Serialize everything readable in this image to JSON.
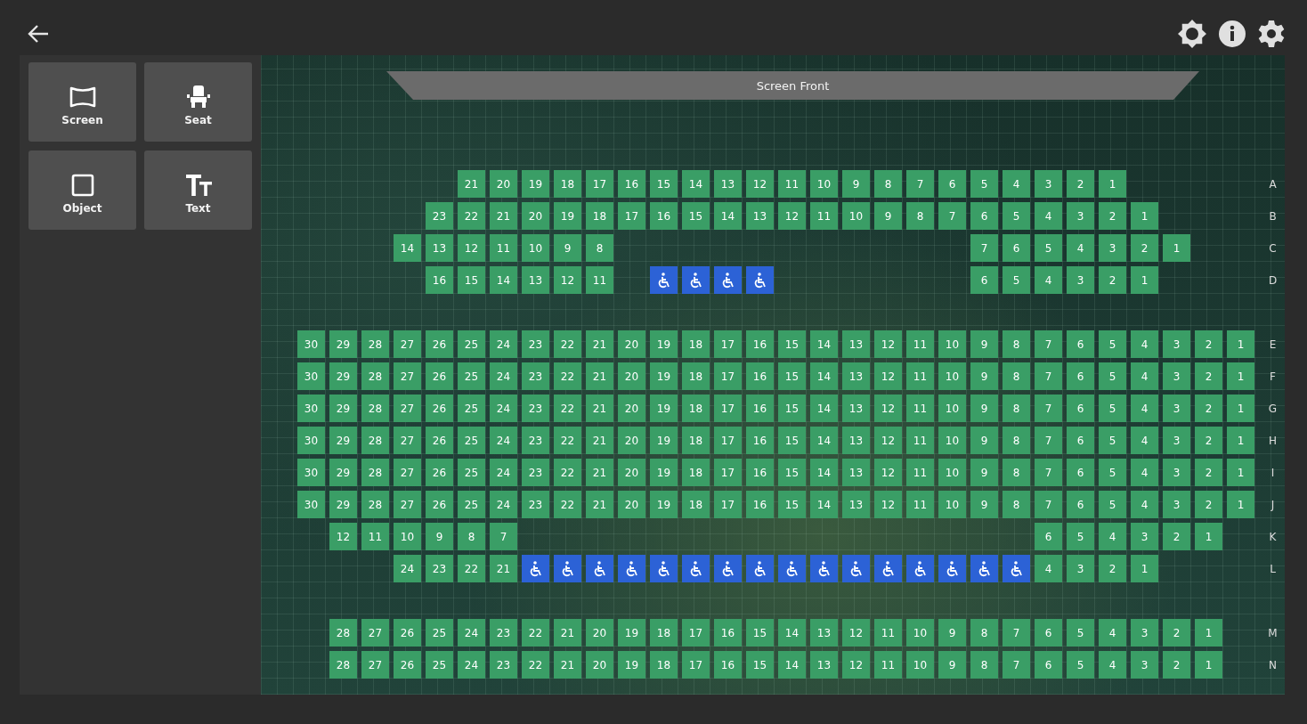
{
  "toolbar": {
    "tools": [
      {
        "kind": "screen",
        "label": "Screen"
      },
      {
        "kind": "seat",
        "label": "Seat"
      },
      {
        "kind": "object",
        "label": "Object"
      },
      {
        "kind": "text",
        "label": "Text"
      }
    ]
  },
  "screen": {
    "label": "Screen Front"
  },
  "rows": [
    {
      "kind": "row",
      "label": "A",
      "seats": [
        {
          "kind": "gap"
        },
        {
          "kind": "gap"
        },
        {
          "kind": "gap"
        },
        {
          "kind": "gap"
        },
        {
          "kind": "gap"
        },
        {
          "kind": "seat",
          "label": "21"
        },
        {
          "kind": "seat",
          "label": "20"
        },
        {
          "kind": "seat",
          "label": "19"
        },
        {
          "kind": "seat",
          "label": "18"
        },
        {
          "kind": "seat",
          "label": "17"
        },
        {
          "kind": "seat",
          "label": "16"
        },
        {
          "kind": "seat",
          "label": "15"
        },
        {
          "kind": "seat",
          "label": "14"
        },
        {
          "kind": "seat",
          "label": "13"
        },
        {
          "kind": "seat",
          "label": "12"
        },
        {
          "kind": "seat",
          "label": "11"
        },
        {
          "kind": "seat",
          "label": "10"
        },
        {
          "kind": "seat",
          "label": "9"
        },
        {
          "kind": "seat",
          "label": "8"
        },
        {
          "kind": "seat",
          "label": "7"
        },
        {
          "kind": "seat",
          "label": "6"
        },
        {
          "kind": "seat",
          "label": "5"
        },
        {
          "kind": "seat",
          "label": "4"
        },
        {
          "kind": "seat",
          "label": "3"
        },
        {
          "kind": "seat",
          "label": "2"
        },
        {
          "kind": "seat",
          "label": "1"
        }
      ]
    },
    {
      "kind": "row",
      "label": "B",
      "seats": [
        {
          "kind": "gap"
        },
        {
          "kind": "gap"
        },
        {
          "kind": "gap"
        },
        {
          "kind": "gap"
        },
        {
          "kind": "seat",
          "label": "23"
        },
        {
          "kind": "seat",
          "label": "22"
        },
        {
          "kind": "seat",
          "label": "21"
        },
        {
          "kind": "seat",
          "label": "20"
        },
        {
          "kind": "seat",
          "label": "19"
        },
        {
          "kind": "seat",
          "label": "18"
        },
        {
          "kind": "seat",
          "label": "17"
        },
        {
          "kind": "seat",
          "label": "16"
        },
        {
          "kind": "seat",
          "label": "15"
        },
        {
          "kind": "seat",
          "label": "14"
        },
        {
          "kind": "seat",
          "label": "13"
        },
        {
          "kind": "seat",
          "label": "12"
        },
        {
          "kind": "seat",
          "label": "11"
        },
        {
          "kind": "seat",
          "label": "10"
        },
        {
          "kind": "seat",
          "label": "9"
        },
        {
          "kind": "seat",
          "label": "8"
        },
        {
          "kind": "seat",
          "label": "7"
        },
        {
          "kind": "seat",
          "label": "6"
        },
        {
          "kind": "seat",
          "label": "5"
        },
        {
          "kind": "seat",
          "label": "4"
        },
        {
          "kind": "seat",
          "label": "3"
        },
        {
          "kind": "seat",
          "label": "2"
        },
        {
          "kind": "seat",
          "label": "1"
        }
      ]
    },
    {
      "kind": "row",
      "label": "C",
      "seats": [
        {
          "kind": "gap"
        },
        {
          "kind": "gap"
        },
        {
          "kind": "gap"
        },
        {
          "kind": "seat",
          "label": "14"
        },
        {
          "kind": "seat",
          "label": "13"
        },
        {
          "kind": "seat",
          "label": "12"
        },
        {
          "kind": "seat",
          "label": "11"
        },
        {
          "kind": "seat",
          "label": "10"
        },
        {
          "kind": "seat",
          "label": "9"
        },
        {
          "kind": "seat",
          "label": "8"
        },
        {
          "kind": "gap"
        },
        {
          "kind": "gap"
        },
        {
          "kind": "gap"
        },
        {
          "kind": "gap"
        },
        {
          "kind": "gap"
        },
        {
          "kind": "gap"
        },
        {
          "kind": "gap"
        },
        {
          "kind": "gap"
        },
        {
          "kind": "gap"
        },
        {
          "kind": "gap"
        },
        {
          "kind": "gap"
        },
        {
          "kind": "seat",
          "label": "7"
        },
        {
          "kind": "seat",
          "label": "6"
        },
        {
          "kind": "seat",
          "label": "5"
        },
        {
          "kind": "seat",
          "label": "4"
        },
        {
          "kind": "seat",
          "label": "3"
        },
        {
          "kind": "seat",
          "label": "2"
        },
        {
          "kind": "seat",
          "label": "1"
        }
      ]
    },
    {
      "kind": "row",
      "label": "D",
      "seats": [
        {
          "kind": "gap"
        },
        {
          "kind": "gap"
        },
        {
          "kind": "gap"
        },
        {
          "kind": "gap"
        },
        {
          "kind": "seat",
          "label": "16"
        },
        {
          "kind": "seat",
          "label": "15"
        },
        {
          "kind": "seat",
          "label": "14"
        },
        {
          "kind": "seat",
          "label": "13"
        },
        {
          "kind": "seat",
          "label": "12"
        },
        {
          "kind": "seat",
          "label": "11"
        },
        {
          "kind": "gap"
        },
        {
          "kind": "wheelchair"
        },
        {
          "kind": "wheelchair"
        },
        {
          "kind": "wheelchair"
        },
        {
          "kind": "wheelchair"
        },
        {
          "kind": "gap"
        },
        {
          "kind": "gap"
        },
        {
          "kind": "gap"
        },
        {
          "kind": "gap"
        },
        {
          "kind": "gap"
        },
        {
          "kind": "gap"
        },
        {
          "kind": "seat",
          "label": "6"
        },
        {
          "kind": "seat",
          "label": "5"
        },
        {
          "kind": "seat",
          "label": "4"
        },
        {
          "kind": "seat",
          "label": "3"
        },
        {
          "kind": "seat",
          "label": "2"
        },
        {
          "kind": "seat",
          "label": "1"
        }
      ]
    },
    {
      "kind": "aisle"
    },
    {
      "kind": "row",
      "label": "E",
      "seats": [
        {
          "kind": "seat",
          "label": "30"
        },
        {
          "kind": "seat",
          "label": "29"
        },
        {
          "kind": "seat",
          "label": "28"
        },
        {
          "kind": "seat",
          "label": "27"
        },
        {
          "kind": "seat",
          "label": "26"
        },
        {
          "kind": "seat",
          "label": "25"
        },
        {
          "kind": "seat",
          "label": "24"
        },
        {
          "kind": "seat",
          "label": "23"
        },
        {
          "kind": "seat",
          "label": "22"
        },
        {
          "kind": "seat",
          "label": "21"
        },
        {
          "kind": "seat",
          "label": "20"
        },
        {
          "kind": "seat",
          "label": "19"
        },
        {
          "kind": "seat",
          "label": "18"
        },
        {
          "kind": "seat",
          "label": "17"
        },
        {
          "kind": "seat",
          "label": "16"
        },
        {
          "kind": "seat",
          "label": "15"
        },
        {
          "kind": "seat",
          "label": "14"
        },
        {
          "kind": "seat",
          "label": "13"
        },
        {
          "kind": "seat",
          "label": "12"
        },
        {
          "kind": "seat",
          "label": "11"
        },
        {
          "kind": "seat",
          "label": "10"
        },
        {
          "kind": "seat",
          "label": "9"
        },
        {
          "kind": "seat",
          "label": "8"
        },
        {
          "kind": "seat",
          "label": "7"
        },
        {
          "kind": "seat",
          "label": "6"
        },
        {
          "kind": "seat",
          "label": "5"
        },
        {
          "kind": "seat",
          "label": "4"
        },
        {
          "kind": "seat",
          "label": "3"
        },
        {
          "kind": "seat",
          "label": "2"
        },
        {
          "kind": "seat",
          "label": "1"
        }
      ]
    },
    {
      "kind": "row",
      "label": "F",
      "seats": [
        {
          "kind": "seat",
          "label": "30"
        },
        {
          "kind": "seat",
          "label": "29"
        },
        {
          "kind": "seat",
          "label": "28"
        },
        {
          "kind": "seat",
          "label": "27"
        },
        {
          "kind": "seat",
          "label": "26"
        },
        {
          "kind": "seat",
          "label": "25"
        },
        {
          "kind": "seat",
          "label": "24"
        },
        {
          "kind": "seat",
          "label": "23"
        },
        {
          "kind": "seat",
          "label": "22"
        },
        {
          "kind": "seat",
          "label": "21"
        },
        {
          "kind": "seat",
          "label": "20"
        },
        {
          "kind": "seat",
          "label": "19"
        },
        {
          "kind": "seat",
          "label": "18"
        },
        {
          "kind": "seat",
          "label": "17"
        },
        {
          "kind": "seat",
          "label": "16"
        },
        {
          "kind": "seat",
          "label": "15"
        },
        {
          "kind": "seat",
          "label": "14"
        },
        {
          "kind": "seat",
          "label": "13"
        },
        {
          "kind": "seat",
          "label": "12"
        },
        {
          "kind": "seat",
          "label": "11"
        },
        {
          "kind": "seat",
          "label": "10"
        },
        {
          "kind": "seat",
          "label": "9"
        },
        {
          "kind": "seat",
          "label": "8"
        },
        {
          "kind": "seat",
          "label": "7"
        },
        {
          "kind": "seat",
          "label": "6"
        },
        {
          "kind": "seat",
          "label": "5"
        },
        {
          "kind": "seat",
          "label": "4"
        },
        {
          "kind": "seat",
          "label": "3"
        },
        {
          "kind": "seat",
          "label": "2"
        },
        {
          "kind": "seat",
          "label": "1"
        }
      ]
    },
    {
      "kind": "row",
      "label": "G",
      "seats": [
        {
          "kind": "seat",
          "label": "30"
        },
        {
          "kind": "seat",
          "label": "29"
        },
        {
          "kind": "seat",
          "label": "28"
        },
        {
          "kind": "seat",
          "label": "27"
        },
        {
          "kind": "seat",
          "label": "26"
        },
        {
          "kind": "seat",
          "label": "25"
        },
        {
          "kind": "seat",
          "label": "24"
        },
        {
          "kind": "seat",
          "label": "23"
        },
        {
          "kind": "seat",
          "label": "22"
        },
        {
          "kind": "seat",
          "label": "21"
        },
        {
          "kind": "seat",
          "label": "20"
        },
        {
          "kind": "seat",
          "label": "19"
        },
        {
          "kind": "seat",
          "label": "18"
        },
        {
          "kind": "seat",
          "label": "17"
        },
        {
          "kind": "seat",
          "label": "16"
        },
        {
          "kind": "seat",
          "label": "15"
        },
        {
          "kind": "seat",
          "label": "14"
        },
        {
          "kind": "seat",
          "label": "13"
        },
        {
          "kind": "seat",
          "label": "12"
        },
        {
          "kind": "seat",
          "label": "11"
        },
        {
          "kind": "seat",
          "label": "10"
        },
        {
          "kind": "seat",
          "label": "9"
        },
        {
          "kind": "seat",
          "label": "8"
        },
        {
          "kind": "seat",
          "label": "7"
        },
        {
          "kind": "seat",
          "label": "6"
        },
        {
          "kind": "seat",
          "label": "5"
        },
        {
          "kind": "seat",
          "label": "4"
        },
        {
          "kind": "seat",
          "label": "3"
        },
        {
          "kind": "seat",
          "label": "2"
        },
        {
          "kind": "seat",
          "label": "1"
        }
      ]
    },
    {
      "kind": "row",
      "label": "H",
      "seats": [
        {
          "kind": "seat",
          "label": "30"
        },
        {
          "kind": "seat",
          "label": "29"
        },
        {
          "kind": "seat",
          "label": "28"
        },
        {
          "kind": "seat",
          "label": "27"
        },
        {
          "kind": "seat",
          "label": "26"
        },
        {
          "kind": "seat",
          "label": "25"
        },
        {
          "kind": "seat",
          "label": "24"
        },
        {
          "kind": "seat",
          "label": "23"
        },
        {
          "kind": "seat",
          "label": "22"
        },
        {
          "kind": "seat",
          "label": "21"
        },
        {
          "kind": "seat",
          "label": "20"
        },
        {
          "kind": "seat",
          "label": "19"
        },
        {
          "kind": "seat",
          "label": "18"
        },
        {
          "kind": "seat",
          "label": "17"
        },
        {
          "kind": "seat",
          "label": "16"
        },
        {
          "kind": "seat",
          "label": "15"
        },
        {
          "kind": "seat",
          "label": "14"
        },
        {
          "kind": "seat",
          "label": "13"
        },
        {
          "kind": "seat",
          "label": "12"
        },
        {
          "kind": "seat",
          "label": "11"
        },
        {
          "kind": "seat",
          "label": "10"
        },
        {
          "kind": "seat",
          "label": "9"
        },
        {
          "kind": "seat",
          "label": "8"
        },
        {
          "kind": "seat",
          "label": "7"
        },
        {
          "kind": "seat",
          "label": "6"
        },
        {
          "kind": "seat",
          "label": "5"
        },
        {
          "kind": "seat",
          "label": "4"
        },
        {
          "kind": "seat",
          "label": "3"
        },
        {
          "kind": "seat",
          "label": "2"
        },
        {
          "kind": "seat",
          "label": "1"
        }
      ]
    },
    {
      "kind": "row",
      "label": "I",
      "seats": [
        {
          "kind": "seat",
          "label": "30"
        },
        {
          "kind": "seat",
          "label": "29"
        },
        {
          "kind": "seat",
          "label": "28"
        },
        {
          "kind": "seat",
          "label": "27"
        },
        {
          "kind": "seat",
          "label": "26"
        },
        {
          "kind": "seat",
          "label": "25"
        },
        {
          "kind": "seat",
          "label": "24"
        },
        {
          "kind": "seat",
          "label": "23"
        },
        {
          "kind": "seat",
          "label": "22"
        },
        {
          "kind": "seat",
          "label": "21"
        },
        {
          "kind": "seat",
          "label": "20"
        },
        {
          "kind": "seat",
          "label": "19"
        },
        {
          "kind": "seat",
          "label": "18"
        },
        {
          "kind": "seat",
          "label": "17"
        },
        {
          "kind": "seat",
          "label": "16"
        },
        {
          "kind": "seat",
          "label": "15"
        },
        {
          "kind": "seat",
          "label": "14"
        },
        {
          "kind": "seat",
          "label": "13"
        },
        {
          "kind": "seat",
          "label": "12"
        },
        {
          "kind": "seat",
          "label": "11"
        },
        {
          "kind": "seat",
          "label": "10"
        },
        {
          "kind": "seat",
          "label": "9"
        },
        {
          "kind": "seat",
          "label": "8"
        },
        {
          "kind": "seat",
          "label": "7"
        },
        {
          "kind": "seat",
          "label": "6"
        },
        {
          "kind": "seat",
          "label": "5"
        },
        {
          "kind": "seat",
          "label": "4"
        },
        {
          "kind": "seat",
          "label": "3"
        },
        {
          "kind": "seat",
          "label": "2"
        },
        {
          "kind": "seat",
          "label": "1"
        }
      ]
    },
    {
      "kind": "row",
      "label": "J",
      "seats": [
        {
          "kind": "seat",
          "label": "30"
        },
        {
          "kind": "seat",
          "label": "29"
        },
        {
          "kind": "seat",
          "label": "28"
        },
        {
          "kind": "seat",
          "label": "27"
        },
        {
          "kind": "seat",
          "label": "26"
        },
        {
          "kind": "seat",
          "label": "25"
        },
        {
          "kind": "seat",
          "label": "24"
        },
        {
          "kind": "seat",
          "label": "23"
        },
        {
          "kind": "seat",
          "label": "22"
        },
        {
          "kind": "seat",
          "label": "21"
        },
        {
          "kind": "seat",
          "label": "20"
        },
        {
          "kind": "seat",
          "label": "19"
        },
        {
          "kind": "seat",
          "label": "18"
        },
        {
          "kind": "seat",
          "label": "17"
        },
        {
          "kind": "seat",
          "label": "16"
        },
        {
          "kind": "seat",
          "label": "15"
        },
        {
          "kind": "seat",
          "label": "14"
        },
        {
          "kind": "seat",
          "label": "13"
        },
        {
          "kind": "seat",
          "label": "12"
        },
        {
          "kind": "seat",
          "label": "11"
        },
        {
          "kind": "seat",
          "label": "10"
        },
        {
          "kind": "seat",
          "label": "9"
        },
        {
          "kind": "seat",
          "label": "8"
        },
        {
          "kind": "seat",
          "label": "7"
        },
        {
          "kind": "seat",
          "label": "6"
        },
        {
          "kind": "seat",
          "label": "5"
        },
        {
          "kind": "seat",
          "label": "4"
        },
        {
          "kind": "seat",
          "label": "3"
        },
        {
          "kind": "seat",
          "label": "2"
        },
        {
          "kind": "seat",
          "label": "1"
        }
      ]
    },
    {
      "kind": "row",
      "label": "K",
      "seats": [
        {
          "kind": "gap"
        },
        {
          "kind": "seat",
          "label": "12"
        },
        {
          "kind": "seat",
          "label": "11"
        },
        {
          "kind": "seat",
          "label": "10"
        },
        {
          "kind": "seat",
          "label": "9"
        },
        {
          "kind": "seat",
          "label": "8"
        },
        {
          "kind": "seat",
          "label": "7"
        },
        {
          "kind": "gap"
        },
        {
          "kind": "gap"
        },
        {
          "kind": "gap"
        },
        {
          "kind": "gap"
        },
        {
          "kind": "gap"
        },
        {
          "kind": "gap"
        },
        {
          "kind": "gap"
        },
        {
          "kind": "gap"
        },
        {
          "kind": "gap"
        },
        {
          "kind": "gap"
        },
        {
          "kind": "gap"
        },
        {
          "kind": "gap"
        },
        {
          "kind": "gap"
        },
        {
          "kind": "gap"
        },
        {
          "kind": "gap"
        },
        {
          "kind": "gap"
        },
        {
          "kind": "seat",
          "label": "6"
        },
        {
          "kind": "seat",
          "label": "5"
        },
        {
          "kind": "seat",
          "label": "4"
        },
        {
          "kind": "seat",
          "label": "3"
        },
        {
          "kind": "seat",
          "label": "2"
        },
        {
          "kind": "seat",
          "label": "1"
        }
      ]
    },
    {
      "kind": "row",
      "label": "L",
      "seats": [
        {
          "kind": "gap"
        },
        {
          "kind": "gap"
        },
        {
          "kind": "gap"
        },
        {
          "kind": "seat",
          "label": "24"
        },
        {
          "kind": "seat",
          "label": "23"
        },
        {
          "kind": "seat",
          "label": "22"
        },
        {
          "kind": "seat",
          "label": "21"
        },
        {
          "kind": "wheelchair"
        },
        {
          "kind": "wheelchair"
        },
        {
          "kind": "wheelchair"
        },
        {
          "kind": "wheelchair"
        },
        {
          "kind": "wheelchair"
        },
        {
          "kind": "wheelchair"
        },
        {
          "kind": "wheelchair"
        },
        {
          "kind": "wheelchair"
        },
        {
          "kind": "wheelchair"
        },
        {
          "kind": "wheelchair"
        },
        {
          "kind": "wheelchair"
        },
        {
          "kind": "wheelchair"
        },
        {
          "kind": "wheelchair"
        },
        {
          "kind": "wheelchair"
        },
        {
          "kind": "wheelchair"
        },
        {
          "kind": "wheelchair"
        },
        {
          "kind": "seat",
          "label": "4"
        },
        {
          "kind": "seat",
          "label": "3"
        },
        {
          "kind": "seat",
          "label": "2"
        },
        {
          "kind": "seat",
          "label": "1"
        }
      ]
    },
    {
      "kind": "aisle"
    },
    {
      "kind": "row",
      "label": "M",
      "seats": [
        {
          "kind": "gap"
        },
        {
          "kind": "seat",
          "label": "28"
        },
        {
          "kind": "seat",
          "label": "27"
        },
        {
          "kind": "seat",
          "label": "26"
        },
        {
          "kind": "seat",
          "label": "25"
        },
        {
          "kind": "seat",
          "label": "24"
        },
        {
          "kind": "seat",
          "label": "23"
        },
        {
          "kind": "seat",
          "label": "22"
        },
        {
          "kind": "seat",
          "label": "21"
        },
        {
          "kind": "seat",
          "label": "20"
        },
        {
          "kind": "seat",
          "label": "19"
        },
        {
          "kind": "seat",
          "label": "18"
        },
        {
          "kind": "seat",
          "label": "17"
        },
        {
          "kind": "seat",
          "label": "16"
        },
        {
          "kind": "seat",
          "label": "15"
        },
        {
          "kind": "seat",
          "label": "14"
        },
        {
          "kind": "seat",
          "label": "13"
        },
        {
          "kind": "seat",
          "label": "12"
        },
        {
          "kind": "seat",
          "label": "11"
        },
        {
          "kind": "seat",
          "label": "10"
        },
        {
          "kind": "seat",
          "label": "9"
        },
        {
          "kind": "seat",
          "label": "8"
        },
        {
          "kind": "seat",
          "label": "7"
        },
        {
          "kind": "seat",
          "label": "6"
        },
        {
          "kind": "seat",
          "label": "5"
        },
        {
          "kind": "seat",
          "label": "4"
        },
        {
          "kind": "seat",
          "label": "3"
        },
        {
          "kind": "seat",
          "label": "2"
        },
        {
          "kind": "seat",
          "label": "1"
        }
      ]
    },
    {
      "kind": "row",
      "label": "N",
      "seats": [
        {
          "kind": "gap"
        },
        {
          "kind": "seat",
          "label": "28"
        },
        {
          "kind": "seat",
          "label": "27"
        },
        {
          "kind": "seat",
          "label": "26"
        },
        {
          "kind": "seat",
          "label": "25"
        },
        {
          "kind": "seat",
          "label": "24"
        },
        {
          "kind": "seat",
          "label": "23"
        },
        {
          "kind": "seat",
          "label": "22"
        },
        {
          "kind": "seat",
          "label": "21"
        },
        {
          "kind": "seat",
          "label": "20"
        },
        {
          "kind": "seat",
          "label": "19"
        },
        {
          "kind": "seat",
          "label": "18"
        },
        {
          "kind": "seat",
          "label": "17"
        },
        {
          "kind": "seat",
          "label": "16"
        },
        {
          "kind": "seat",
          "label": "15"
        },
        {
          "kind": "seat",
          "label": "14"
        },
        {
          "kind": "seat",
          "label": "13"
        },
        {
          "kind": "seat",
          "label": "12"
        },
        {
          "kind": "seat",
          "label": "11"
        },
        {
          "kind": "seat",
          "label": "10"
        },
        {
          "kind": "seat",
          "label": "9"
        },
        {
          "kind": "seat",
          "label": "8"
        },
        {
          "kind": "seat",
          "label": "7"
        },
        {
          "kind": "seat",
          "label": "6"
        },
        {
          "kind": "seat",
          "label": "5"
        },
        {
          "kind": "seat",
          "label": "4"
        },
        {
          "kind": "seat",
          "label": "3"
        },
        {
          "kind": "seat",
          "label": "2"
        },
        {
          "kind": "seat",
          "label": "1"
        }
      ]
    }
  ]
}
